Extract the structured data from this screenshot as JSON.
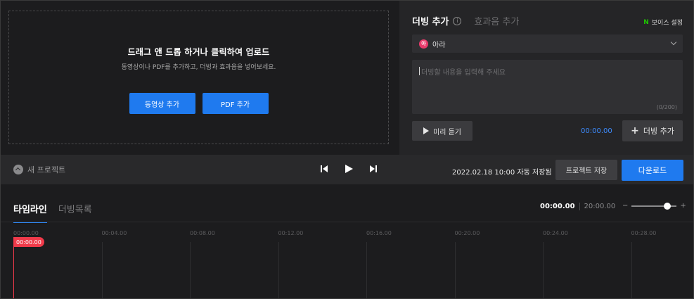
{
  "upload": {
    "title": "드래그 앤 드롭 하거나 클릭하여 업로드",
    "subtitle": "동영상이나 PDF를 추가하고, 더빙과 효과음을 넣어보세요.",
    "add_video_label": "동영상 추가",
    "add_pdf_label": "PDF 추가"
  },
  "dubbing": {
    "tab_active": "더빙 추가",
    "info_icon": "ⓘ",
    "tab_inactive": "효과음 추가",
    "voice_setting_brand": "N",
    "voice_setting_label": "보이스 설정",
    "voice_avatar": "아",
    "voice_name": "아라",
    "placeholder": "더빙할 내용을 입력해 주세요",
    "counter": "(0/200)",
    "preview_label": "미리 듣기",
    "time": "00:00.00",
    "add_label": "더빙 추가"
  },
  "controlbar": {
    "project_name": "새 프로젝트",
    "saved_text": "2022.02.18 10:00 자동 저장됨",
    "save_label": "프로젝트 저장",
    "download_label": "다운로드"
  },
  "timeline": {
    "tabs": [
      "타임라인",
      "더빙목록"
    ],
    "current_time": "00:00.00",
    "total_time": "20:00.00",
    "zoom_minus": "−",
    "zoom_plus": "+",
    "zoom_level": 0.8,
    "playhead": "00:00.00",
    "ticks": [
      "00:00.00",
      "00:04.00",
      "00:08.00",
      "00:12.00",
      "00:16.00",
      "00:20.00",
      "00:24.00",
      "00:28.00"
    ]
  },
  "colors": {
    "accent": "#1f7aef",
    "playhead": "#f03a4a",
    "naver_green": "#1ec800",
    "avatar": "#e83a6b"
  }
}
